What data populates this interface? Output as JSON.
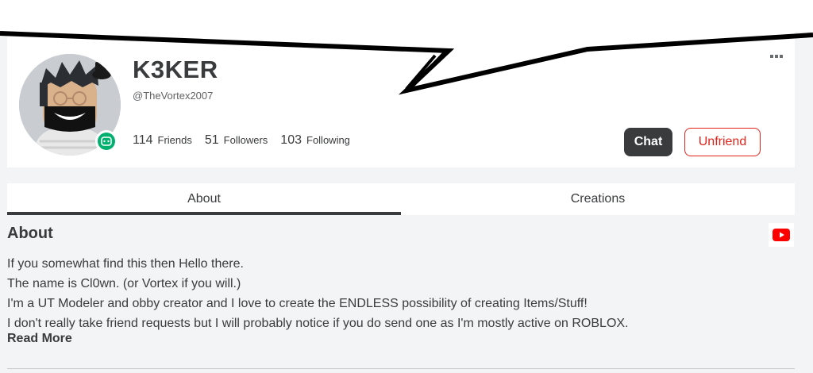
{
  "profile": {
    "display_name": "K3KER",
    "username": "@TheVortex2007",
    "presence": "gamepad-icon",
    "stats": [
      {
        "count": "114",
        "label": "Friends"
      },
      {
        "count": "51",
        "label": "Followers"
      },
      {
        "count": "103",
        "label": "Following"
      }
    ]
  },
  "actions": {
    "more_icon": "more-dots-icon",
    "chat_label": "Chat",
    "unfriend_label": "Unfriend"
  },
  "tabs": [
    {
      "label": "About",
      "active": true
    },
    {
      "label": "Creations",
      "active": false
    }
  ],
  "about": {
    "heading": "About",
    "lines": [
      "If you somewhat find this then Hello there.",
      "The name is Cl0wn. (or Vortex if you will.)",
      "I'm a UT Modeler and obby creator and I love to create the ENDLESS possibility of creating Items/Stuff!",
      "I don't really take friend requests but I will probably notice if you do send one as I'm mostly active on ROBLOX."
    ],
    "read_more": "Read More",
    "social_icon": "youtube-icon"
  },
  "colors": {
    "accent_dark": "#393b3d",
    "unfriend_red": "#e2231a",
    "presence_green": "#00b06f",
    "youtube_red": "#ff0000"
  }
}
